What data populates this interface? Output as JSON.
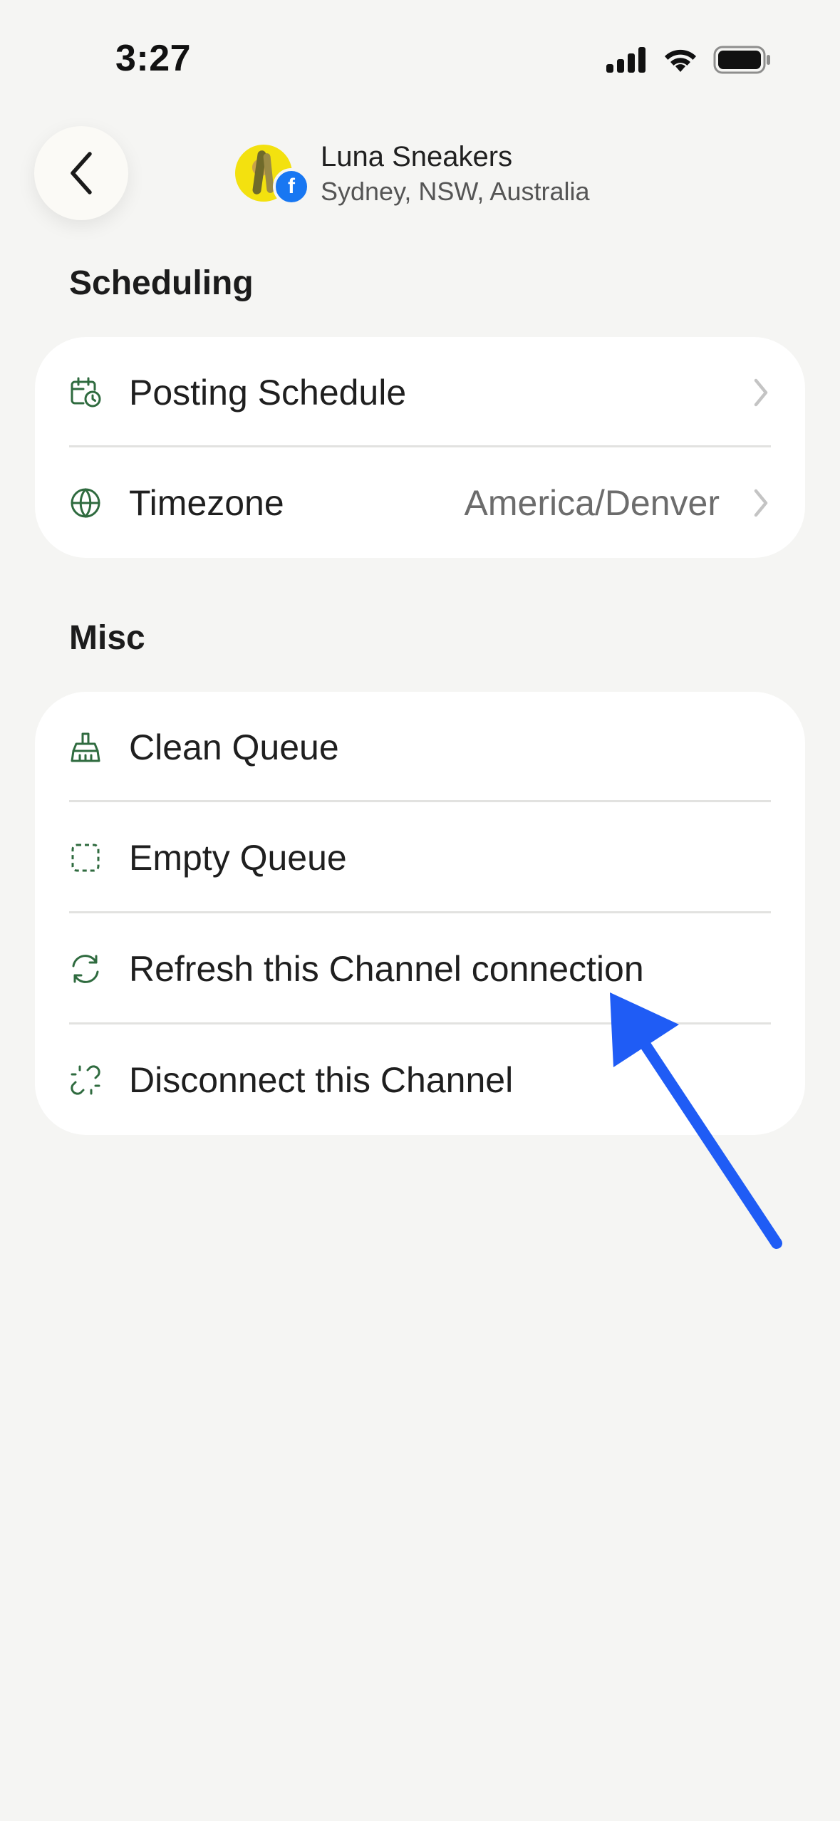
{
  "status_bar": {
    "time": "3:27"
  },
  "header": {
    "profile_name": "Luna Sneakers",
    "profile_location": "Sydney, NSW, Australia",
    "network_badge": "f"
  },
  "sections": {
    "scheduling": {
      "heading": "Scheduling",
      "rows": [
        {
          "label": "Posting Schedule",
          "icon": "calendar-clock-icon"
        },
        {
          "label": "Timezone",
          "value": "America/Denver",
          "icon": "globe-icon"
        }
      ]
    },
    "misc": {
      "heading": "Misc",
      "rows": [
        {
          "label": "Clean Queue",
          "icon": "broom-icon"
        },
        {
          "label": "Empty Queue",
          "icon": "dashed-square-icon"
        },
        {
          "label": "Refresh this Channel connection",
          "icon": "refresh-icon"
        },
        {
          "label": "Disconnect this Channel",
          "icon": "broken-link-icon"
        }
      ]
    }
  },
  "colors": {
    "background": "#f5f5f3",
    "card": "#ffffff",
    "icon_green": "#2f6b3f",
    "annotation_arrow": "#1f5cf5",
    "facebook_blue": "#1877f2"
  }
}
